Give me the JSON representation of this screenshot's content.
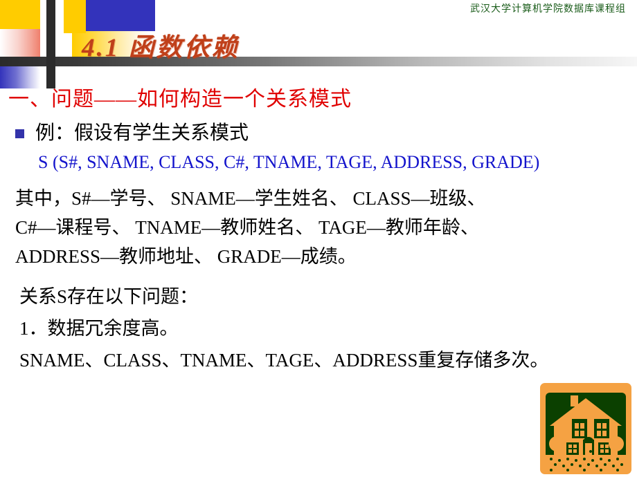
{
  "header": {
    "course_group": "武汉大学计算机学院数据库课程组"
  },
  "title": {
    "text": "4.1  函数依赖",
    "color": "#c0401a"
  },
  "content": {
    "section_heading": "一、问题——如何构造一个关系模式",
    "section_heading_color": "#e00000",
    "bullet": {
      "marker": "square-bullet",
      "text": "例：假设有学生关系模式"
    },
    "schema": {
      "text": "S (S#, SNAME, CLASS, C#, TNAME, TAGE, ADDRESS, GRADE)",
      "color": "#1414cc"
    },
    "legend_lines": [
      "其中，S#—学号、 SNAME—学生姓名、 CLASS—班级、",
      "C#—课程号、 TNAME—教师姓名、 TAGE—教师年龄、",
      "ADDRESS—教师地址、 GRADE—成绩。"
    ],
    "problem_lines": [
      "关系S存在以下问题：",
      "1．数据冗余度高。",
      "SNAME、CLASS、TNAME、TAGE、ADDRESS重复存储多次。"
    ]
  },
  "decorations": {
    "yellow": "#FFCC00",
    "blue": "#3333bb",
    "dark_bar": "#2b2b2b",
    "house_background": "#F5A243",
    "house_foreground": "#0B4000"
  },
  "house_icon": {
    "name": "house-clipart"
  }
}
